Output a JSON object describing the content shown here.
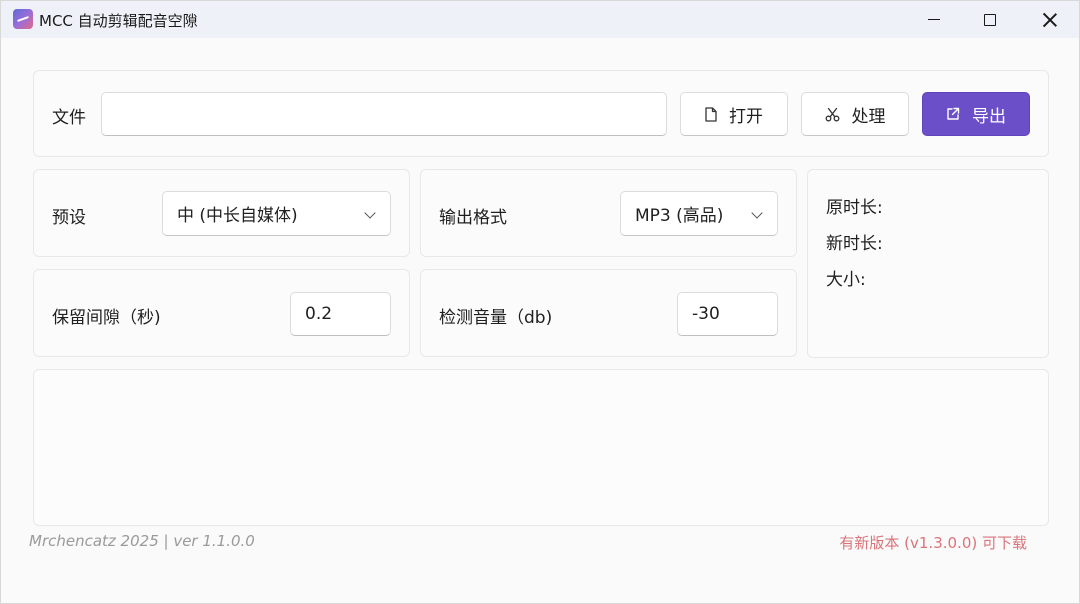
{
  "window": {
    "title": "MCC 自动剪辑配音空隙"
  },
  "file_row": {
    "label": "文件",
    "value": "",
    "open_label": "打开",
    "process_label": "处理",
    "export_label": "导出"
  },
  "preset": {
    "label": "预设",
    "selected": "中 (中长自媒体)"
  },
  "output_format": {
    "label": "输出格式",
    "selected": "MP3 (高品)"
  },
  "gap": {
    "label": "保留间隙（秒)",
    "value": "0.2"
  },
  "volume": {
    "label": "检测音量（db)",
    "value": "-30"
  },
  "info": {
    "original_duration_label": "原时长:",
    "new_duration_label": "新时长:",
    "size_label": "大小:"
  },
  "footer": {
    "credit": "Mrchencatz 2025 | ver 1.1.0.0",
    "update_notice": "有新版本 (v1.3.0.0) 可下载"
  },
  "colors": {
    "accent": "#6b4fc8",
    "update_text": "#d9747a"
  },
  "icons": {
    "open": "file-icon",
    "process": "scissors-icon",
    "export": "external-link-icon"
  }
}
